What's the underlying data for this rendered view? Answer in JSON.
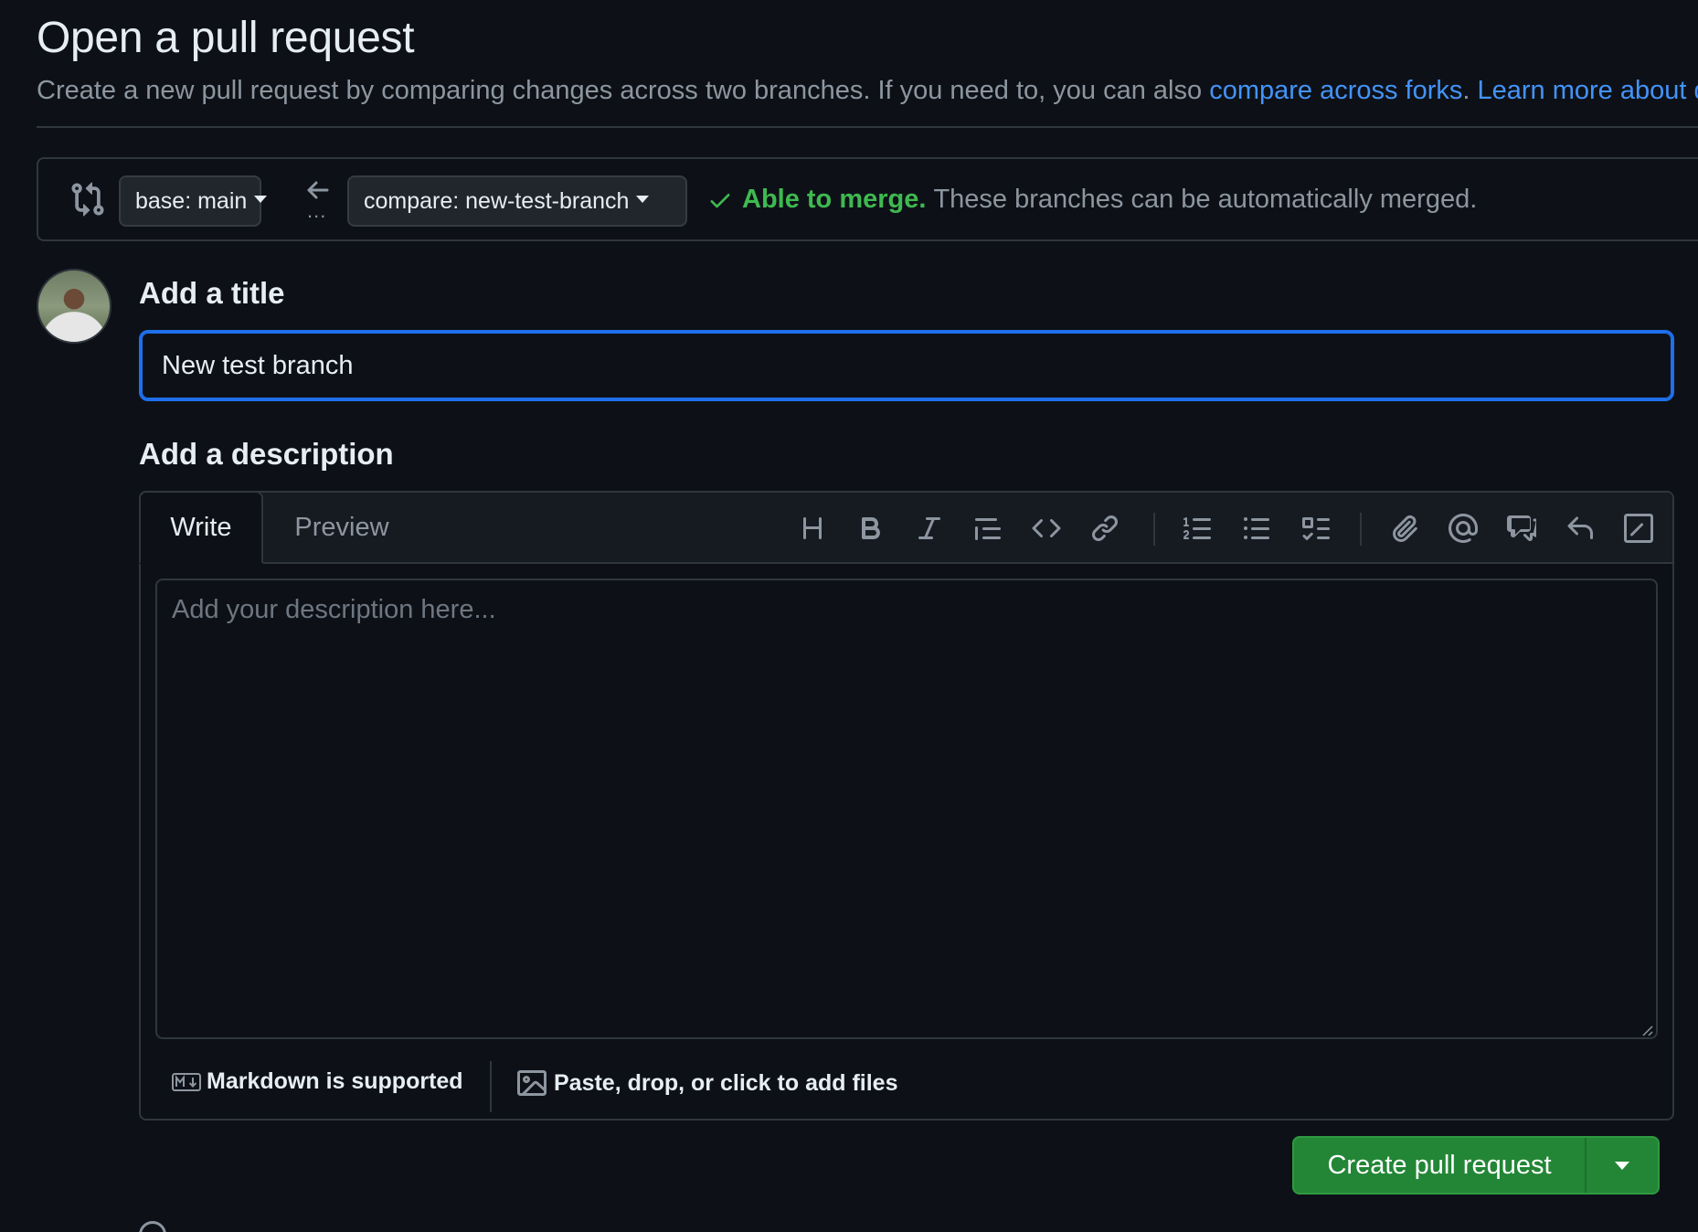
{
  "header": {
    "title": "Open a pull request",
    "subtitle_text": "Create a new pull request by comparing changes across two branches. If you need to, you can also ",
    "compare_forks_link": "compare across forks",
    "period": ".",
    "learn_more_link": "Learn more about d"
  },
  "range": {
    "base_label": "base: main",
    "compare_label": "compare: new-test-branch",
    "ellipsis": "...",
    "merge_ok": "Able to merge.",
    "merge_rest": "These branches can be automatically merged."
  },
  "form": {
    "title_label": "Add a title",
    "title_value": "New test branch",
    "description_label": "Add a description",
    "description_placeholder": "Add your description here...",
    "tabs": [
      {
        "label": "Write",
        "active": true
      },
      {
        "label": "Preview",
        "active": false
      }
    ],
    "toolbar_icons": [
      "heading-icon",
      "bold-icon",
      "italic-icon",
      "quote-icon",
      "code-icon",
      "link-icon",
      "numbered-list-icon",
      "unordered-list-icon",
      "task-list-icon",
      "attach-file-icon",
      "mention-icon",
      "cross-reference-icon",
      "reply-icon",
      "slash-commands-icon"
    ],
    "footer": {
      "markdown_label": "Markdown is supported",
      "files_label": "Paste, drop, or click to add files"
    }
  },
  "actions": {
    "create_label": "Create pull request"
  },
  "colors": {
    "background": "#0d1117",
    "accent_blue": "#4493f8",
    "focus_border": "#1f6feb",
    "success_green": "#3fb950",
    "button_green": "#238636",
    "muted_text": "#8d96a0"
  }
}
